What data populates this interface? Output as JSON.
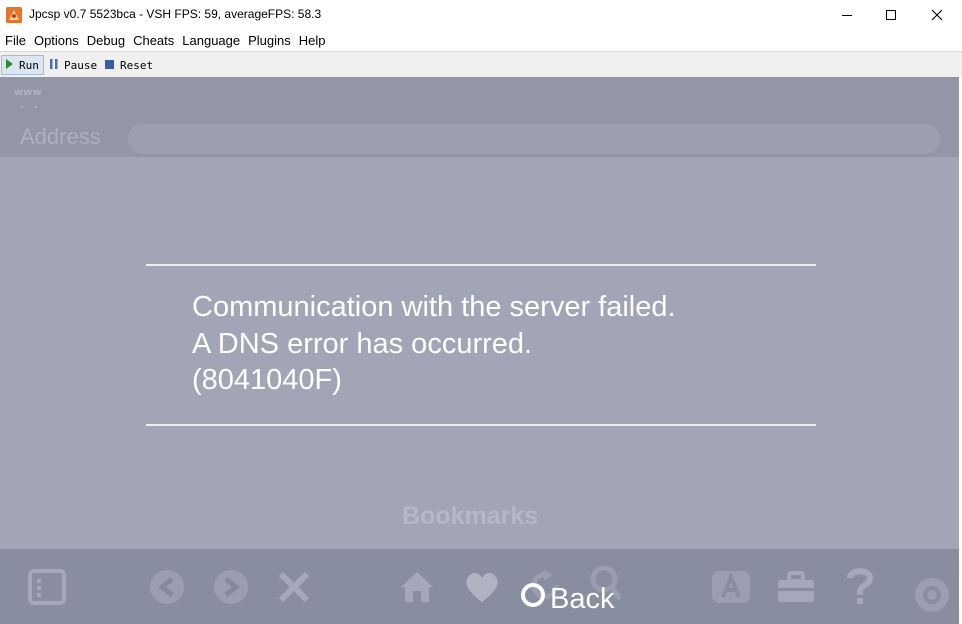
{
  "window": {
    "title": "Jpcsp v0.7 5523bca - VSH FPS: 59, averageFPS: 58.3",
    "app_icon": "jpcsp-app-icon"
  },
  "menu": [
    "File",
    "Options",
    "Debug",
    "Cheats",
    "Language",
    "Plugins",
    "Help"
  ],
  "toolbar": {
    "run_label": "Run",
    "pause_label": "Pause",
    "reset_label": "Reset"
  },
  "browser": {
    "www_label": "www",
    "address_label": "Address",
    "error_lines": [
      "Communication with the server failed.",
      "A DNS error has occurred.",
      "(8041040F)"
    ],
    "bookmarks_label": "Bookmarks",
    "back_label": "Back",
    "bottom_icons": [
      "list-icon",
      "left-arrow-icon",
      "right-arrow-icon",
      "close-icon",
      "home-icon",
      "heart-icon",
      "refresh-icon",
      "search-icon",
      "a-text-icon",
      "toolbox-icon",
      "help-icon",
      "settings-icon"
    ]
  },
  "colors": {
    "screen_bg": "#a1a5b6",
    "top_bar": "#9396a6",
    "bottom_bar": "#898da0",
    "error_text": "#ffffff"
  }
}
